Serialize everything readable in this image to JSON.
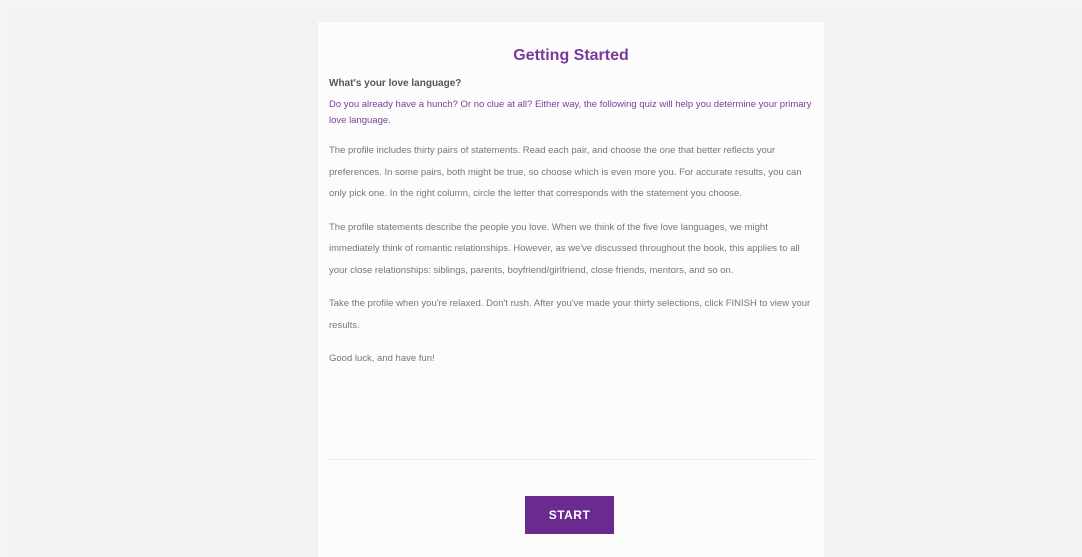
{
  "card": {
    "title": "Getting Started",
    "subtitle": "What's your love language?",
    "intro": "Do you already have a hunch? Or no clue at all? Either way, the following quiz will help you determine your primary love language.",
    "paragraphs": [
      "The profile includes thirty pairs of statements. Read each pair, and choose the one that better reflects your preferences. In some pairs, both might be true, so choose which is even more you. For accurate results, you can only pick one. In the right column, circle the letter that corresponds with the statement you choose.",
      "The profile statements describe the people you love. When we think of the five love languages, we might immediately think of romantic relationships. However, as we've discussed throughout the book, this applies to all your close relationships: siblings, parents, boyfriend/girlfriend, close friends, mentors, and so on.",
      "Take the profile when you're relaxed. Don't rush. After you've made your thirty selections, click FINISH to view your results.",
      "Good luck, and have fun!"
    ],
    "start_label": "START"
  }
}
